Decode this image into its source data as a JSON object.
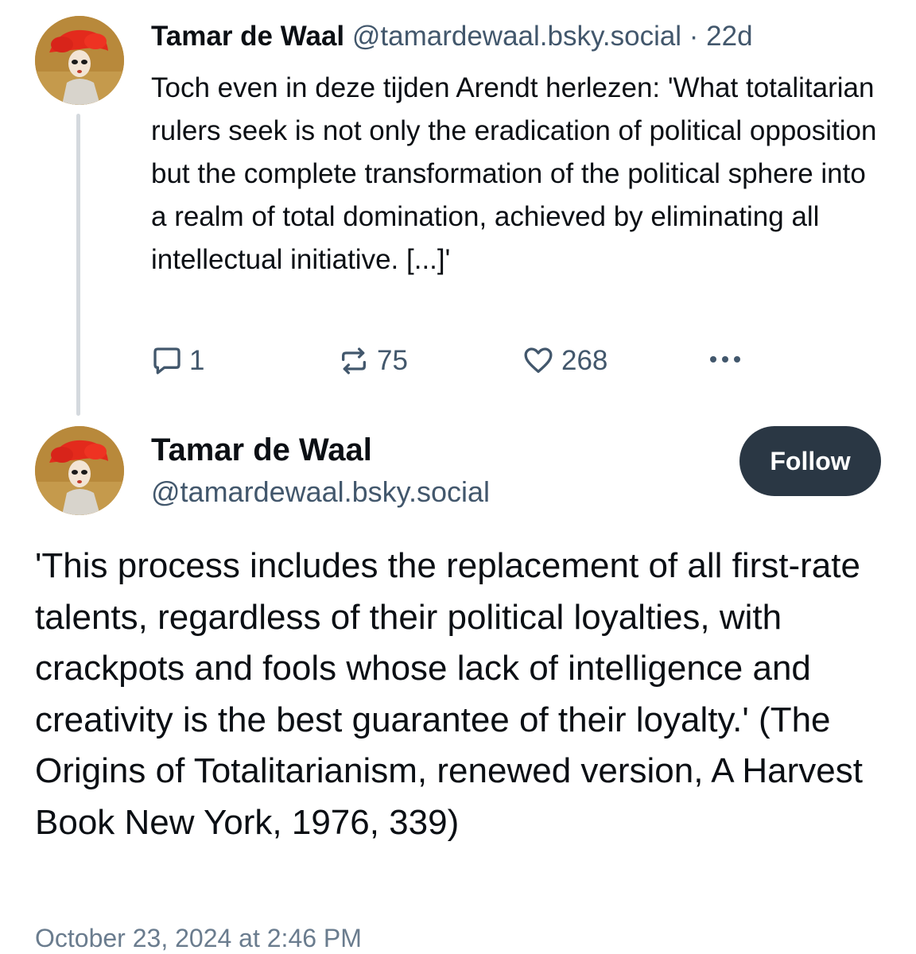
{
  "parent_post": {
    "author_name": "Tamar de Waal",
    "meta": "@tamardewaal.bsky.social · 22d",
    "text": "Toch even in deze tijden Arendt herlezen: 'What totalitarian rulers seek is not only the eradication of political opposition but the complete transformation of the political sphere into a realm of total domination, achieved by eliminating all intellectual initiative. [...]'",
    "reply_count": "1",
    "repost_count": "75",
    "like_count": "268",
    "avatar_icon": "profile-painting-red-hat"
  },
  "main_post": {
    "author_name": "Tamar de Waal",
    "handle": "@tamardewaal.bsky.social",
    "follow_label": "Follow",
    "text": "'This process includes the replacement of all first-rate talents, regardless of their political loyalties, with crackpots and fools whose lack of intelligence and creativity is the best guarantee of their loyalty.' (The Origins of Totalitarianism, renewed version, A Harvest Book New York, 1976, 339)",
    "timestamp": "October 23, 2024 at 2:46 PM"
  },
  "colors": {
    "text": "#0b0f14",
    "secondary": "#42576c",
    "button": "#2a3744",
    "thread_line": "#d4d9de"
  }
}
